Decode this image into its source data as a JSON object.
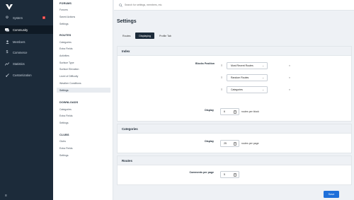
{
  "sidebar": {
    "items": [
      {
        "label": "System",
        "icon": "gear-icon",
        "badge": "2"
      },
      {
        "label": "Community",
        "icon": "chat-icon",
        "active": true
      },
      {
        "label": "Members",
        "icon": "user-icon"
      },
      {
        "label": "Commerce",
        "icon": "dollar-icon"
      },
      {
        "label": "Statistics",
        "icon": "chart-icon"
      },
      {
        "label": "Customization",
        "icon": "brush-icon"
      }
    ],
    "bottom_icon": "menu-icon"
  },
  "subnav": {
    "forums": {
      "heading": "FORUMS",
      "items": [
        "Forums",
        "Saved Actions",
        "Settings"
      ]
    },
    "routes": {
      "heading": "ROUTES",
      "items": [
        "Categories",
        "Extra Fields",
        "Activities",
        "Surface Type",
        "Surface Elevation",
        "Level of Difficulty",
        "Weather Conditions",
        "Settings"
      ],
      "active": "Settings"
    },
    "downloads": {
      "heading": "DOWNLOADS",
      "items": [
        "Categories",
        "Extra Fields",
        "Settings"
      ]
    },
    "clubs": {
      "heading": "CLUBS",
      "items": [
        "Clubs",
        "Extra Fields",
        "Settings"
      ]
    }
  },
  "search": {
    "placeholder": "Search for settings, members, etc."
  },
  "page": {
    "title": "Settings",
    "tabs": [
      {
        "label": "Routes"
      },
      {
        "label": "Displaying",
        "active": true
      },
      {
        "label": "Profile Tab"
      }
    ]
  },
  "index": {
    "heading": "Index",
    "blocks_label": "Blocks Position",
    "blocks": [
      "Most Recent Routes",
      "Random Routes",
      "Categories"
    ],
    "display_label": "Display",
    "display_value": "6",
    "display_unit": "routes per block"
  },
  "categories": {
    "heading": "Categories",
    "display_label": "Display",
    "display_value": "25",
    "display_unit": "routes per page"
  },
  "routes": {
    "heading": "Routes",
    "comments_label": "Comments per page",
    "comments_value": "5"
  },
  "save_label": "Save"
}
